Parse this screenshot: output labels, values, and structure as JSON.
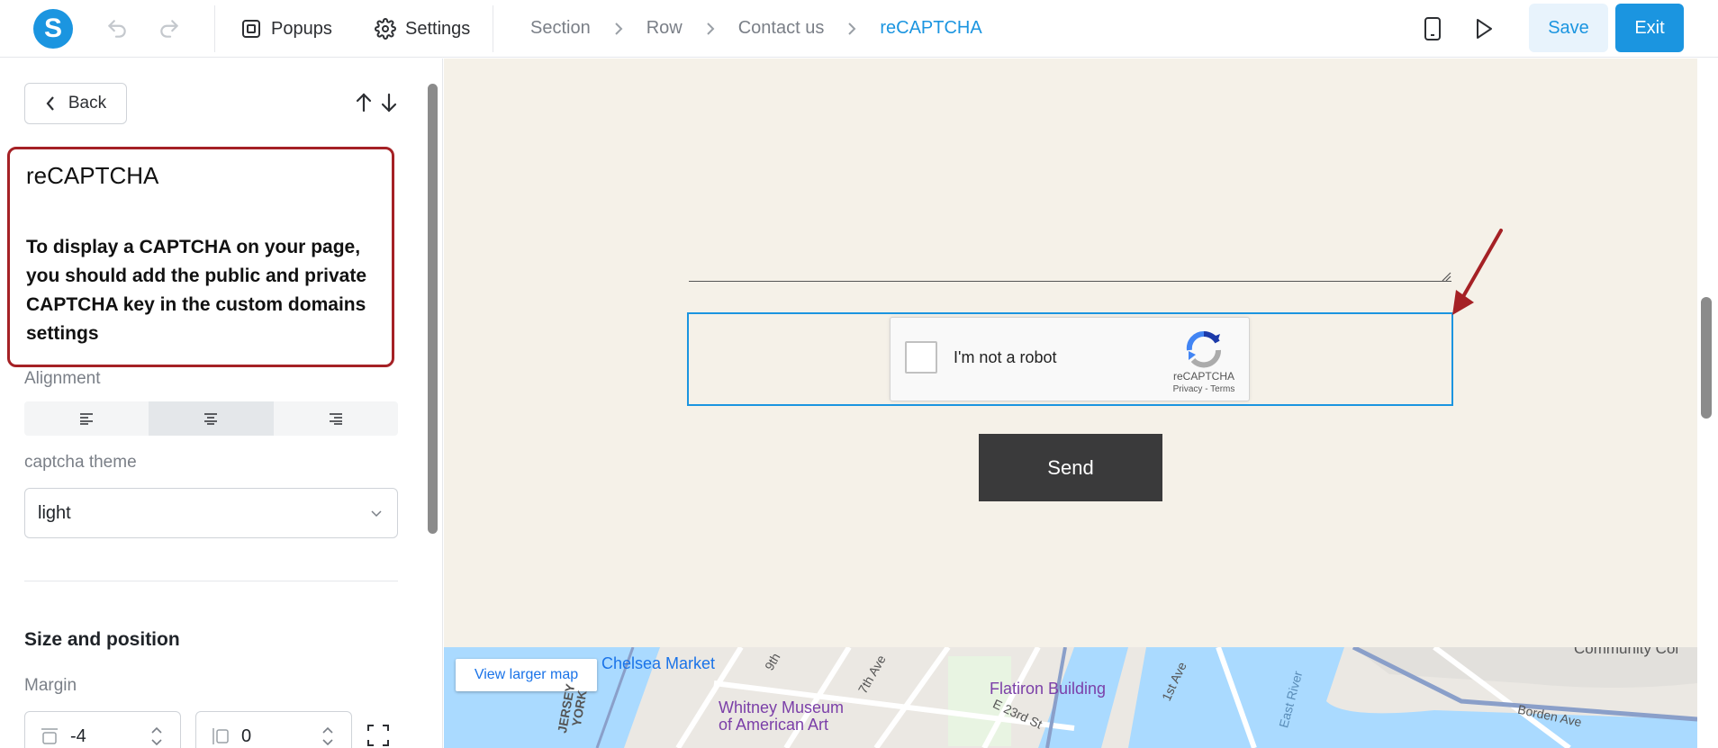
{
  "topbar": {
    "logo_letter": "S",
    "popups_label": "Popups",
    "settings_label": "Settings",
    "breadcrumb": [
      "Section",
      "Row",
      "Contact us",
      "reCAPTCHA"
    ],
    "save_label": "Save",
    "exit_label": "Exit",
    "accent_color": "#1b95e0"
  },
  "panel": {
    "back_label": "Back",
    "notice_title": "reCAPTCHA",
    "notice_text": "To display a CAPTCHA on your page, you should add the public and private CAPTCHA key in the custom domains settings",
    "alignment_label": "Alignment",
    "alignment_selected": "center",
    "theme_label": "captcha theme",
    "theme_value": "light",
    "size_position_title": "Size and position",
    "margin_label": "Margin",
    "margin_top_value": "-4",
    "margin_side_value": "0"
  },
  "canvas": {
    "captcha_text": "I'm not a robot",
    "captcha_brand": "reCAPTCHA",
    "captcha_terms": "Privacy - Terms",
    "send_label": "Send"
  },
  "map": {
    "view_larger": "View larger map",
    "places": {
      "chelsea": "Chelsea Market",
      "whitney_1": "Whitney Museum",
      "whitney_2": "of American Art",
      "flatiron": "Flatiron Building",
      "jersey": "JERSEY",
      "york": "YORK",
      "ninth": "9th",
      "seventh": "7th Ave",
      "e23": "E 23rd St",
      "first": "1st Ave",
      "east_river": "East River",
      "borden": "Borden Ave",
      "community": "Community Col"
    }
  }
}
